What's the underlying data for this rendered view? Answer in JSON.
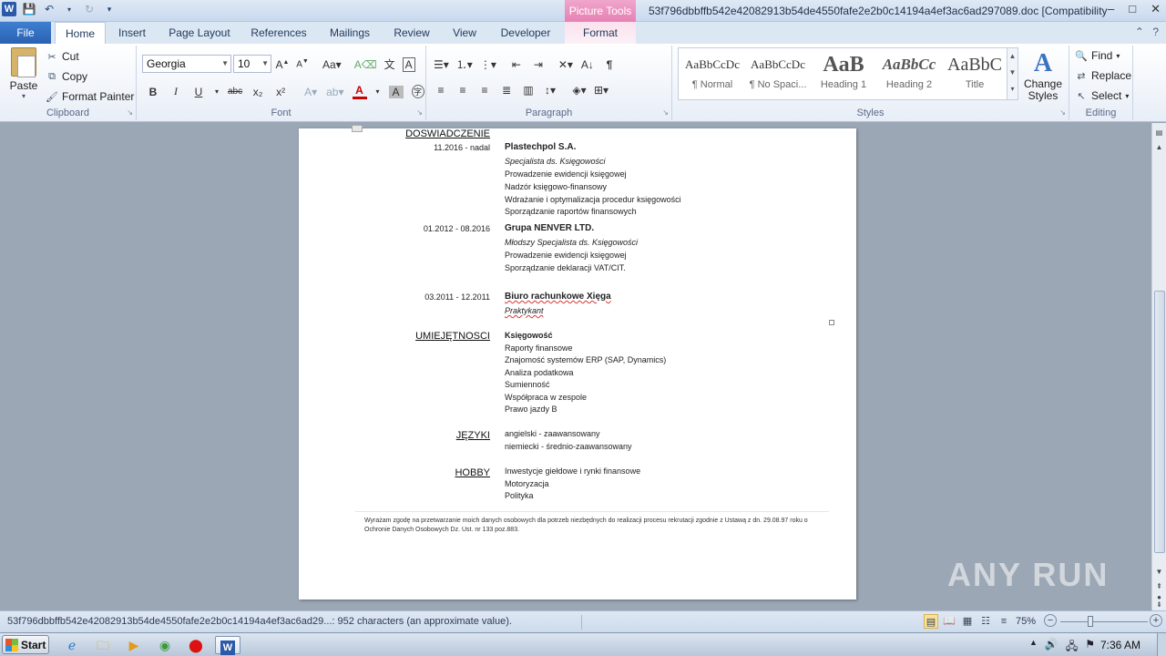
{
  "title_bar": {
    "app_icon_letter": "W",
    "qat": [
      "save-icon",
      "undo-icon",
      "redo-icon",
      "customize-icon"
    ],
    "contextual_tab_group": "Picture Tools",
    "window_title": "53f796dbbffb542e42082913b54de4550fafe2e2b0c14194a4ef3ac6ad297089.doc [Compatibility Mo...",
    "controls": {
      "minimize": "–",
      "maximize": "□",
      "close": "✕"
    }
  },
  "tabs": [
    "File",
    "Home",
    "Insert",
    "Page Layout",
    "References",
    "Mailings",
    "Review",
    "View",
    "Developer",
    "Format"
  ],
  "active_tab": "Home",
  "ribbon": {
    "clipboard": {
      "paste": "Paste",
      "cut": "Cut",
      "copy": "Copy",
      "format_painter": "Format Painter",
      "label": "Clipboard"
    },
    "font": {
      "family": "Georgia",
      "size": "10",
      "label": "Font"
    },
    "paragraph": {
      "label": "Paragraph"
    },
    "styles": {
      "label": "Styles",
      "items": [
        {
          "preview": "AaBbCcDc",
          "name": "¶ Normal"
        },
        {
          "preview": "AaBbCcDc",
          "name": "¶ No Spaci..."
        },
        {
          "preview": "AaB",
          "name": "Heading 1"
        },
        {
          "preview": "AaBbCc",
          "name": "Heading 2"
        },
        {
          "preview": "AaBbC",
          "name": "Title"
        }
      ],
      "change_styles": "Change Styles"
    },
    "editing": {
      "find": "Find",
      "replace": "Replace",
      "select": "Select",
      "label": "Editing"
    }
  },
  "document": {
    "experience_heading": "DOSWIADCZENIE",
    "jobs": [
      {
        "dates": "11.2016  - nadal",
        "company": "Plastechpol S.A.",
        "role": "Specjalista ds. Księgowości",
        "duties": [
          "Prowadzenie ewidencji księgowej",
          "Nadzór księgowo-finansowy",
          "Wdrażanie i optymalizacja procedur księgowości",
          "Sporządzanie raportów finansowych"
        ]
      },
      {
        "dates": "01.2012  - 08.2016",
        "company": "Grupa NENVER LTD.",
        "role": "Młodszy Specjalista ds. Księgowości",
        "duties": [
          "Prowadzenie ewidencji księgowej",
          "Sporządzanie deklaracji VAT/CIT."
        ]
      },
      {
        "dates": "03.2011  - 12.2011",
        "company": "Biuro rachunkowe Xięga",
        "role": "Praktykant",
        "duties": []
      }
    ],
    "skills_heading": "UMIEJĘTNOSCI",
    "skills": [
      "Księgowość",
      "Raporty finansowe",
      "Znajomość systemów  ERP (SAP, Dynamics)",
      "Analiza podatkowa",
      "Sumienność",
      "Współpraca w zespole",
      "Prawo jazdy B"
    ],
    "languages_heading": "JĘZYKI",
    "languages": [
      "angielski  - zaawansowany",
      "niemiecki  - średnio-zaawansowany"
    ],
    "hobby_heading": "HOBBY",
    "hobbies": [
      "Inwestycje giełdowe  i rynki finansowe",
      "Motoryzacja",
      "Polityka"
    ],
    "consent": "Wyrażam zgodę na przetwarzanie  moich danych osobowych dla potrzeb niezbędnych  do realizacji procesu rekrutacji zgodnie z Ustawą z dn. 29.08.97 roku o Ochronie  Danych Osobowych Dz. Ust. nr 133 poz.883."
  },
  "watermark": "ANY RUN",
  "status_bar": {
    "text": "53f796dbbffb542e42082913b54de4550fafe2e2b0c14194a4ef3ac6ad29...: 952 characters (an approximate value).",
    "zoom": "75%"
  },
  "taskbar": {
    "start": "Start",
    "clock": "7:36 AM"
  }
}
